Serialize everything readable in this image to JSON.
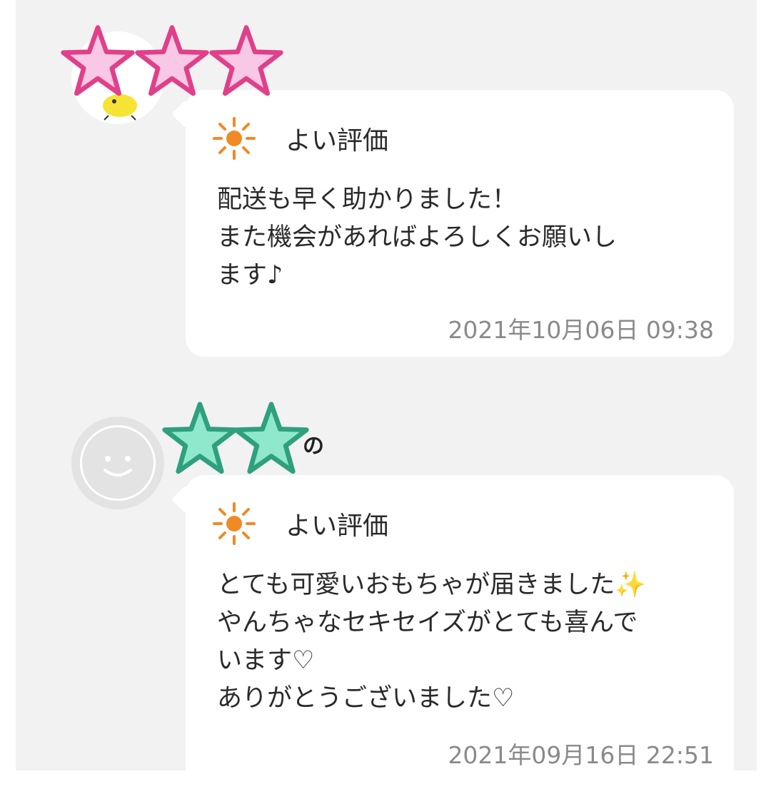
{
  "reviews": [
    {
      "rating_label": "よい評価",
      "comment_lines": [
        "配送も早く助かりました！",
        "また機会があればよろしくお願いし",
        "ます♪"
      ],
      "timestamp": "2021年10月06日 09:38",
      "name_fragment": "",
      "stars_overlay": 3,
      "star_color": "#f8c8e6",
      "star_stroke": "#e0408a"
    },
    {
      "rating_label": "よい評価",
      "comment_lines": [
        "とても可愛いおもちゃが届きました✨",
        "やんちゃなセキセイズがとても喜んで",
        "います♡",
        "ありがとうございました♡"
      ],
      "timestamp": "2021年09月16日 22:51",
      "name_fragment": "の",
      "stars_overlay": 2,
      "star_color": "#8fe8cc",
      "star_stroke": "#2fa07e"
    }
  ],
  "icons": {
    "rating": "sun-icon",
    "avatar_1": "chick-avatar-icon",
    "avatar_2": "smiley-avatar-icon",
    "overlay": "star-icon"
  },
  "colors": {
    "sun": "#f08a24",
    "background": "#f2f2f2",
    "timestamp": "#8a8a8a"
  }
}
